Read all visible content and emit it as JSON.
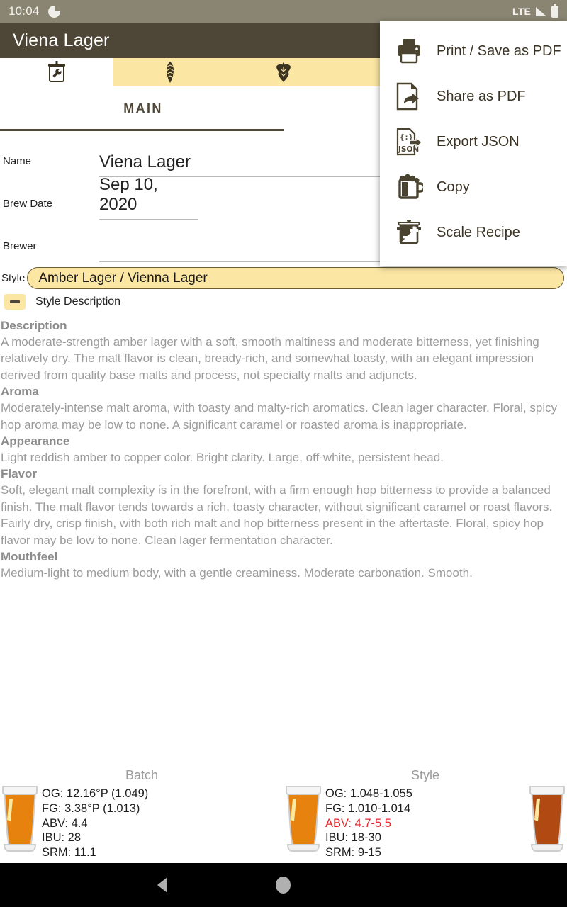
{
  "status_bar": {
    "time": "10:04",
    "network": "LTE",
    "icons": [
      "clock-icon",
      "signal-icon",
      "battery-icon"
    ]
  },
  "app_bar": {
    "title": "Viena Lager"
  },
  "tabs": [
    {
      "name": "tab-main",
      "icon": "brew-pot-wrench-icon",
      "selected": true
    },
    {
      "name": "tab-fermentables",
      "icon": "grain-icon",
      "selected": false
    },
    {
      "name": "tab-hops",
      "icon": "hop-icon",
      "selected": false
    },
    {
      "name": "tab-mash",
      "icon": "thermometer-icon",
      "selected": false
    },
    {
      "name": "tab-yeast",
      "icon": "flask-icon",
      "selected": false
    }
  ],
  "section": {
    "main_label": "MAIN"
  },
  "form": {
    "fields": [
      {
        "label": "Name",
        "value": "Viena Lager"
      },
      {
        "label": "Brew Date",
        "value": "Sep 10, 2020"
      },
      {
        "label": "Brewer",
        "value": ""
      }
    ],
    "style": {
      "label": "Style",
      "value": "Amber Lager / Vienna Lager"
    }
  },
  "style_description": {
    "toggle_label": "Style Description",
    "toggle_icon": "minus-icon",
    "sections": [
      {
        "heading": "Description",
        "text": "A moderate-strength amber lager with a soft, smooth maltiness and moderate bitterness, yet finishing relatively dry. The malt flavor is clean, bready-rich, and somewhat toasty, with an elegant impression derived from quality base malts and process, not specialty malts and adjuncts."
      },
      {
        "heading": "Aroma",
        "text": "Moderately-intense malt aroma, with toasty and malty-rich aromatics. Clean lager character. Floral, spicy hop aroma may be low to none. A significant caramel or roasted aroma is inappropriate."
      },
      {
        "heading": "Appearance",
        "text": "Light reddish amber to copper color. Bright clarity. Large, off-white, persistent head."
      },
      {
        "heading": "Flavor",
        "text": "Soft, elegant malt complexity is in the forefront, with a firm enough hop bitterness to provide a balanced finish. The malt flavor tends towards a rich, toasty character, without significant caramel or roast flavors. Fairly dry, crisp finish, with both rich malt and hop bitterness present in the aftertaste. Floral, spicy hop flavor may be low to none. Clean lager fermentation character."
      },
      {
        "heading": "Mouthfeel",
        "text": "Medium-light to medium body, with a gentle creaminess. Moderate carbonation. Smooth."
      }
    ]
  },
  "stats": {
    "batch": {
      "title": "Batch",
      "lines": [
        {
          "text": "OG: 12.16°P (1.049)",
          "highlight": false
        },
        {
          "text": "FG: 3.38°P (1.013)",
          "highlight": false
        },
        {
          "text": "ABV: 4.4",
          "highlight": false
        },
        {
          "text": "IBU: 28",
          "highlight": false
        },
        {
          "text": "SRM: 11.1",
          "highlight": false
        }
      ],
      "glass_color": "#e8820e"
    },
    "style": {
      "title": "Style",
      "lines": [
        {
          "text": "OG: 1.048-1.055",
          "highlight": false
        },
        {
          "text": "FG: 1.010-1.014",
          "highlight": false
        },
        {
          "text": "ABV: 4.7-5.5",
          "highlight": true
        },
        {
          "text": "IBU: 18-30",
          "highlight": false
        },
        {
          "text": "SRM: 9-15",
          "highlight": false
        }
      ],
      "glass_color": "#e8820e",
      "glass_color_right": "#b14a12"
    },
    "highlight_color": "#e8242a"
  },
  "menu": {
    "items": [
      {
        "label": "Print / Save as PDF",
        "icon": "printer-icon"
      },
      {
        "label": "Share as PDF",
        "icon": "share-document-icon"
      },
      {
        "label": "Export JSON",
        "icon": "json-export-icon"
      },
      {
        "label": "Copy",
        "icon": "beer-mug-icon"
      },
      {
        "label": "Scale Recipe",
        "icon": "scale-pot-icon"
      }
    ]
  },
  "nav_bar": {
    "back": "back-triangle-icon",
    "home": "home-circle-icon"
  },
  "colors": {
    "appbar": "#4e4636",
    "accent": "#fce6a4",
    "statusbar": "#8a8573"
  }
}
